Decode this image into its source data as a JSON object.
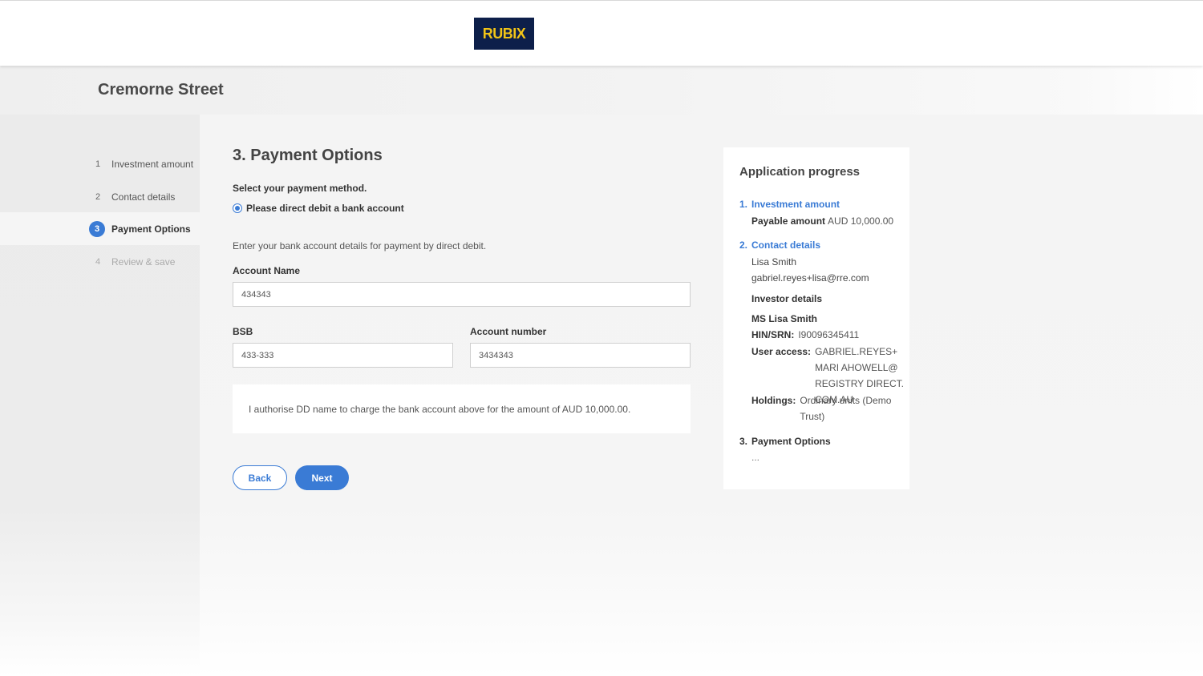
{
  "header": {
    "logo_text": "RUBIX"
  },
  "site": {
    "title": "Cremorne Street"
  },
  "steps": [
    {
      "num": "1",
      "label": "Investment amount",
      "state": "done"
    },
    {
      "num": "2",
      "label": "Contact details",
      "state": "done"
    },
    {
      "num": "3",
      "label": "Payment Options",
      "state": "active"
    },
    {
      "num": "4",
      "label": "Review & save",
      "state": "disabled"
    }
  ],
  "main": {
    "title": "3. Payment Options",
    "select_label": "Select your payment method.",
    "radio_label": "Please direct debit a bank account",
    "intro": "Enter your bank account details for payment by direct debit.",
    "account_name": {
      "label": "Account Name",
      "value": "434343"
    },
    "bsb": {
      "label": "BSB",
      "value": "433-333"
    },
    "account_number": {
      "label": "Account number",
      "value": "3434343"
    },
    "authorisation": "I authorise DD name to charge the bank account above for the amount of AUD 10,000.00.",
    "back_label": "Back",
    "next_label": "Next"
  },
  "progress": {
    "title": "Application progress",
    "s1": {
      "num": "1.",
      "label": "Investment amount",
      "payable_key": "Payable amount",
      "payable_value": "AUD 10,000.00"
    },
    "s2": {
      "num": "2.",
      "label": "Contact details",
      "name": "Lisa Smith",
      "email": "gabriel.reyes+lisa@rre.com",
      "investor_heading": "Investor details",
      "investor_name": "MS Lisa Smith",
      "hin_key": "HIN/SRN:",
      "hin_value": "I90096345411",
      "access_key": "User access:",
      "access_value": "GABRIEL.REYES+MARI AHOWELL@REGISTRY DIRECT.COM.AU",
      "holdings_key": "Holdings:",
      "holdings_value": "Ordinary units (Demo Trust)"
    },
    "s3": {
      "num": "3.",
      "label": "Payment Options",
      "placeholder": "..."
    }
  },
  "colors": {
    "accent": "#3a7bd5",
    "logo_bg": "#0d1f4a",
    "logo_text": "#f2c417"
  }
}
